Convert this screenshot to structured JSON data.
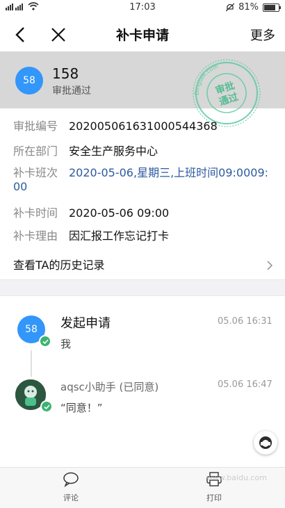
{
  "status_bar": {
    "time": "17:03",
    "battery": "81%"
  },
  "nav": {
    "title": "补卡申请",
    "more_label": "更多"
  },
  "header": {
    "avatar_text": "58",
    "name": "158",
    "status": "审批通过"
  },
  "stamp": {
    "line1": "审批",
    "line2": "通过",
    "ring_text": "Dingtalk.com"
  },
  "details": [
    {
      "label": "审批编号",
      "value": "202005061631000544368"
    },
    {
      "label": "所在部门",
      "value": "安全生产服务中心"
    },
    {
      "label": "补卡班次",
      "value_line1": "2020-05-06,星期三,上班时间09:0009:",
      "value_line2": "00"
    },
    {
      "label": "补卡时间",
      "value": "2020-05-06 09:00"
    },
    {
      "label": "补卡理由",
      "value": "因汇报工作忘记打卡"
    }
  ],
  "history": {
    "label": "查看TA的历史记录"
  },
  "timeline": [
    {
      "avatar_text": "58",
      "title": "发起申请",
      "subtitle": "我",
      "time": "05.06 16:31"
    },
    {
      "name": "aqsc小助手 (已同意)",
      "comment": "“同意！”",
      "time": "05.06 16:47"
    }
  ],
  "bottom_bar": {
    "comment_label": "评论",
    "print_label": "打印",
    "watermark": "www.baidu.com"
  }
}
